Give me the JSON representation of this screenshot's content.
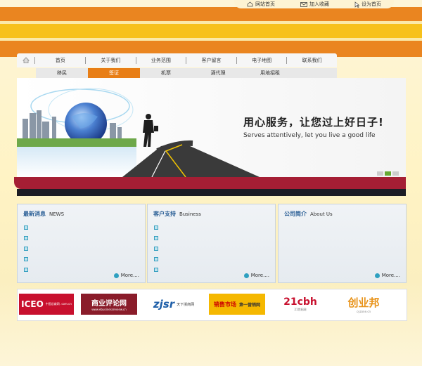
{
  "top_links": [
    {
      "label": "网站首页",
      "icon": "home-icon"
    },
    {
      "label": "加入收藏",
      "icon": "envelope-icon"
    },
    {
      "label": "设为首页",
      "icon": "cursor-icon"
    }
  ],
  "nav": {
    "home_icon": "home-icon",
    "items": [
      "首页",
      "关于我们",
      "业务范围",
      "客户留言",
      "电子地图",
      "联系我们"
    ]
  },
  "subnav": {
    "items": [
      "移民",
      "签证",
      "机票",
      "酒代理",
      "用地招租"
    ],
    "active_index": 1
  },
  "banner": {
    "slogan_cn": "用心服务，让您过上好日子!",
    "slogan_en": "Serves attentively, let you live a good life"
  },
  "panels": [
    {
      "title": "最新消息",
      "subtitle": "NEWS",
      "more": "More....",
      "bullets": 5
    },
    {
      "title": "客户支持",
      "subtitle": "Business",
      "more": "More....",
      "bullets": 5
    },
    {
      "title": "公司简介",
      "subtitle": "About Us",
      "more": "More....",
      "bullets": 0
    }
  ],
  "logos": [
    {
      "main": "ICEO",
      "sub": "中国总裁网 .com.cn"
    },
    {
      "main": "商业评论网",
      "sub": "www.ebusinessreview.cn"
    },
    {
      "main": "zjsr",
      "sub": "天下浙商网"
    },
    {
      "main": "销售市场",
      "sub": "第一营销网"
    },
    {
      "main": "21cbh",
      "sub": "21世纪网"
    },
    {
      "main": "创业邦",
      "sub": "cyzone.cn"
    }
  ],
  "colors": {
    "orange": "#ea8520",
    "yellow": "#f7c11b",
    "crimson": "#a51e34",
    "accent_blue": "#2a5f96"
  }
}
